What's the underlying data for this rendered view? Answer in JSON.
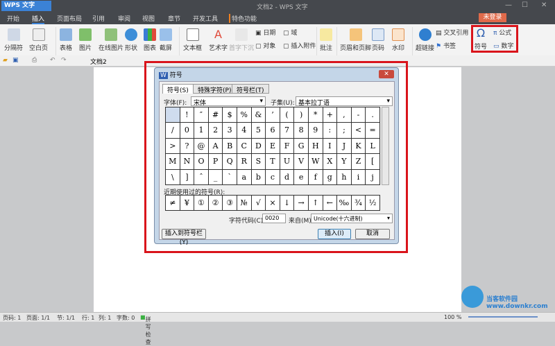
{
  "app": {
    "name": "WPS 文字",
    "title": "文档2 - WPS 文字",
    "login": "未登录"
  },
  "tabs": [
    "开始",
    "插入",
    "页面布局",
    "引用",
    "审阅",
    "视图",
    "章节",
    "开发工具",
    "特色功能"
  ],
  "ribbon": [
    "分隔符",
    "空白页",
    "表格",
    "图片",
    "在线图片",
    "形状",
    "图表",
    "截屏",
    "文本框",
    "艺术字",
    "首字下沉",
    "日期",
    "对象",
    "域",
    "插入附件",
    "批注",
    "页眉和页脚",
    "页码",
    "水印",
    "超链接",
    "交叉引用",
    "书签",
    "符号",
    "公式",
    "数字"
  ],
  "doc_tab": "文档2",
  "dialog": {
    "title": "符号",
    "tabs": [
      "符号(S)",
      "特殊字符(P)",
      "符号栏(T)"
    ],
    "font_label": "字体(F):",
    "font_value": "宋体",
    "subset_label": "子集(U):",
    "subset_value": "基本拉丁语",
    "symbols": [
      "",
      "!",
      "″",
      "#",
      "$",
      "%",
      "&",
      "’",
      "(",
      ")",
      "*",
      "+",
      ",",
      "-",
      ".",
      "/",
      "0",
      "1",
      "2",
      "3",
      "4",
      "5",
      "6",
      "7",
      "8",
      "9",
      ":",
      ";",
      "<",
      "=",
      ">",
      "?",
      "@",
      "A",
      "B",
      "C",
      "D",
      "E",
      "F",
      "G",
      "H",
      "I",
      "J",
      "K",
      "L",
      "M",
      "N",
      "O",
      "P",
      "Q",
      "R",
      "S",
      "T",
      "U",
      "V",
      "W",
      "X",
      "Y",
      "Z",
      "[",
      "\\",
      "]",
      "ˆ",
      "_",
      "`",
      "a",
      "b",
      "c",
      "d",
      "e",
      "f",
      "g",
      "h",
      "i",
      "j"
    ],
    "recent_label": "近期使用过的符号(R):",
    "recent": [
      "≠",
      "¥",
      "①",
      "②",
      "③",
      "№",
      "√",
      "×",
      "↓",
      "→",
      "↑",
      "←",
      "‰",
      "¾",
      "½"
    ],
    "code_label": "字符代码(C):",
    "code_value": "0020",
    "from_label": "来自(M)",
    "from_value": "Unicode(十六进制)",
    "add_to_bar": "插入到符号栏(Y)",
    "insert": "插入(I)",
    "cancel": "取消"
  },
  "status": [
    "页码: 1",
    "页面: 1/1",
    "节: 1/1",
    "行: 1",
    "列: 1",
    "字数: 0",
    "拼写检查",
    "100 %"
  ],
  "watermark": "当客软件园 www.downkr.com"
}
